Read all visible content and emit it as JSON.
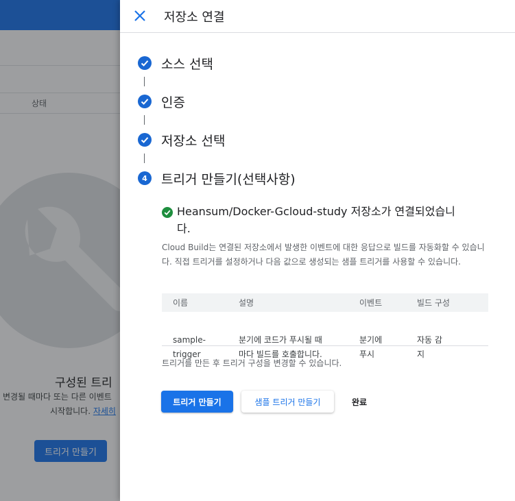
{
  "background": {
    "table_header_status": "상태",
    "empty_title": "구성된 트리",
    "empty_desc_line1": "변경될 때마다 또는 다른 이벤트",
    "empty_desc_line2": "시작합니다.",
    "learn_more": "자세히",
    "create_trigger_button": "트리거 만들기"
  },
  "panel": {
    "title": "저장소 연결",
    "steps": [
      {
        "number": "",
        "label": "소스 선택",
        "status": "done"
      },
      {
        "number": "",
        "label": "인증",
        "status": "done"
      },
      {
        "number": "",
        "label": "저장소 선택",
        "status": "done"
      },
      {
        "number": "4",
        "label": "트리거 만들기(선택사항)",
        "status": "active"
      }
    ],
    "success_line1": "Heansum/Docker-Gcloud-study 저장소가 연결되었습니",
    "success_line2": "다.",
    "description": "Cloud Build는 연결된 저장소에서 발생한 이벤트에 대한 응답으로 빌드를 자동화할 수 있습니다. 직접 트리거를 설정하거나 다음 값으로 생성되는 샘플 트리거를 사용할 수 있습니다.",
    "table": {
      "headers": [
        "이름",
        "설명",
        "이벤트",
        "빌드 구성"
      ],
      "rows": [
        {
          "name_line1": "sample-",
          "name_line2": "trigger",
          "desc_line1": "분기에 코드가 푸시될 때",
          "desc_line2": "마다 빌드를 호출합니다.",
          "event_line1": "분기에",
          "event_line2": "푸시",
          "config_line1": "자동 감",
          "config_line2": "지"
        }
      ]
    },
    "note": "트리거를 만든 후 트리거 구성을 변경할 수 있습니다.",
    "buttons": {
      "create": "트리거 만들기",
      "create_sample": "샘플 트리거 만들기",
      "done": "완료"
    }
  },
  "colors": {
    "primary": "#1a73e8",
    "step_icon": "#1967d2",
    "success": "#1e8e3e"
  }
}
